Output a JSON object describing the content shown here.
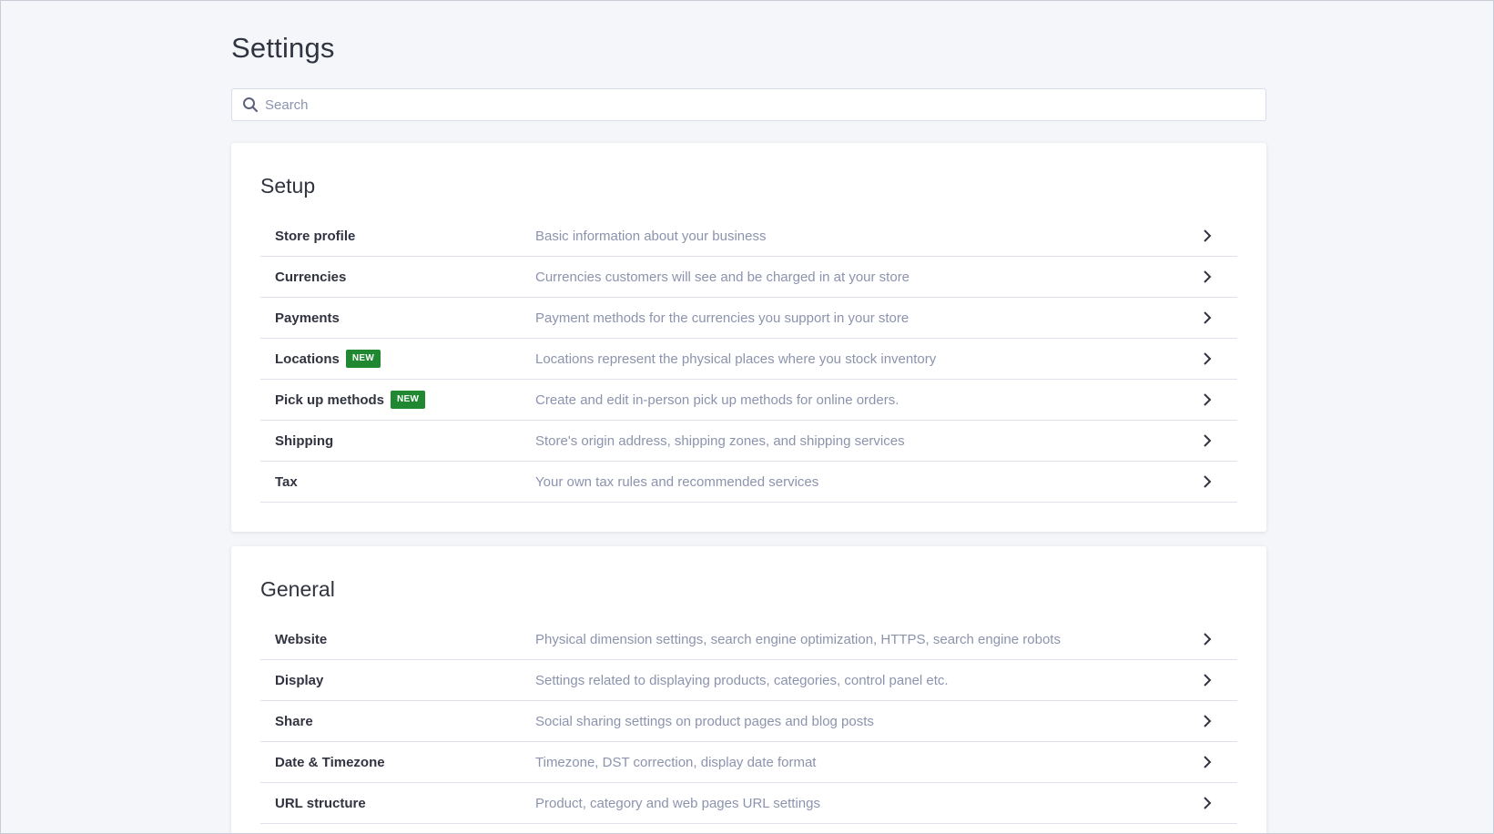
{
  "page": {
    "title": "Settings"
  },
  "search": {
    "placeholder": "Search",
    "value": "",
    "icon": "search-icon"
  },
  "sections": [
    {
      "title": "Setup",
      "items": [
        {
          "label": "Store profile",
          "description": "Basic information about your business",
          "badge": ""
        },
        {
          "label": "Currencies",
          "description": "Currencies customers will see and be charged in at your store",
          "badge": ""
        },
        {
          "label": "Payments",
          "description": "Payment methods for the currencies you support in your store",
          "badge": ""
        },
        {
          "label": "Locations",
          "description": "Locations represent the physical places where you stock inventory",
          "badge": "NEW"
        },
        {
          "label": "Pick up methods",
          "description": "Create and edit in-person pick up methods for online orders.",
          "badge": "NEW"
        },
        {
          "label": "Shipping",
          "description": "Store's origin address, shipping zones, and shipping services",
          "badge": ""
        },
        {
          "label": "Tax",
          "description": "Your own tax rules and recommended services",
          "badge": ""
        }
      ]
    },
    {
      "title": "General",
      "items": [
        {
          "label": "Website",
          "description": "Physical dimension settings, search engine optimization, HTTPS, search engine robots",
          "badge": ""
        },
        {
          "label": "Display",
          "description": "Settings related to displaying products, categories, control panel etc.",
          "badge": ""
        },
        {
          "label": "Share",
          "description": "Social sharing settings on product pages and blog posts",
          "badge": ""
        },
        {
          "label": "Date & Timezone",
          "description": "Timezone, DST correction, display date format",
          "badge": ""
        },
        {
          "label": "URL structure",
          "description": "Product, category and web pages URL settings",
          "badge": ""
        }
      ]
    }
  ],
  "colors": {
    "background": "#f5f6fa",
    "badge": "#208831",
    "text_primary": "#313440",
    "text_secondary": "#8c93ad"
  }
}
